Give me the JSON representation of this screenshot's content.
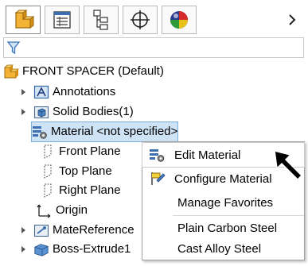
{
  "tree": {
    "root_label": "FRONT SPACER  (Default)",
    "items": [
      {
        "label": "Annotations"
      },
      {
        "label": "Solid Bodies(1)"
      },
      {
        "label": "Material <not specified>"
      },
      {
        "label": "Front Plane"
      },
      {
        "label": "Top Plane"
      },
      {
        "label": "Right Plane"
      },
      {
        "label": "Origin"
      },
      {
        "label": "MateReference"
      },
      {
        "label": "Boss-Extrude1"
      }
    ]
  },
  "context_menu": {
    "items": [
      {
        "label": "Edit Material"
      },
      {
        "label": "Configure Material"
      },
      {
        "label": "Manage Favorites"
      },
      {
        "label": "Plain Carbon Steel"
      },
      {
        "label": "Cast Alloy Steel"
      }
    ]
  }
}
